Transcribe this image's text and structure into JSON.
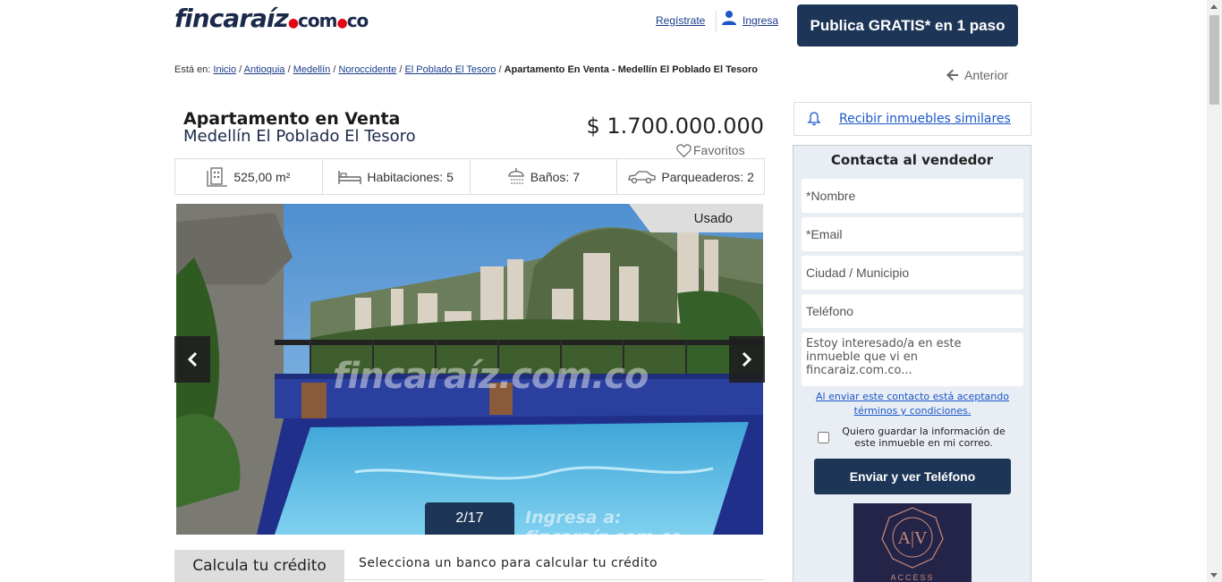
{
  "header": {
    "logo_text": "fincaraíz",
    "logo_domain": "com",
    "logo_tld": "co",
    "register_label": "Regístrate",
    "login_label": "Ingresa",
    "publish_label": "Publica GRATIS* en 1 paso"
  },
  "breadcrumb": {
    "prefix": "Está en:",
    "items": [
      "Inicio",
      "Antioquia",
      "Medellín",
      "Noroccidente",
      "El Poblado El Tesoro"
    ],
    "current": "Apartamento En Venta - Medellín El Poblado El Tesoro",
    "back_label": "Anterior"
  },
  "listing": {
    "type": "Apartamento en Venta",
    "location": "Medellín El Poblado El Tesoro",
    "price": "$ 1.700.000.000",
    "favorites_label": "Favoritos",
    "features": {
      "area": "525,00 m²",
      "rooms": "Habitaciones: 5",
      "baths": "Baños: 7",
      "parking": "Parqueaderos: 2"
    },
    "condition_badge": "Usado",
    "photo_counter": "2/17",
    "watermark": "fincaraíz.com.co",
    "watermark_login": "Ingresa a: fincaraíz.com.co"
  },
  "credit": {
    "tab_label": "Calcula tu crédito",
    "prompt": "Selecciona un banco para calcular tu crédito"
  },
  "sidebar": {
    "alert_label": "Recibir inmuebles similares",
    "contact_title": "Contacta al vendedor",
    "name_placeholder": "*Nombre",
    "email_placeholder": "*Email",
    "city_placeholder": "Ciudad / Municipio",
    "phone_placeholder": "Teléfono",
    "message_placeholder": "Estoy interesado/a en este inmueble que vi en fincaraiz.com.co...",
    "terms_text": "Al enviar este contacto está aceptando términos y condiciones.",
    "save_info_label": "Quiero guardar la información de este inmueble en mi correo.",
    "send_label": "Enviar y ver Teléfono",
    "agency_name": "ACCESS INMOBILIARIA"
  },
  "colors": {
    "brand_navy": "#1d3557",
    "link_blue": "#1a56c8",
    "logo_red": "#e30613"
  }
}
